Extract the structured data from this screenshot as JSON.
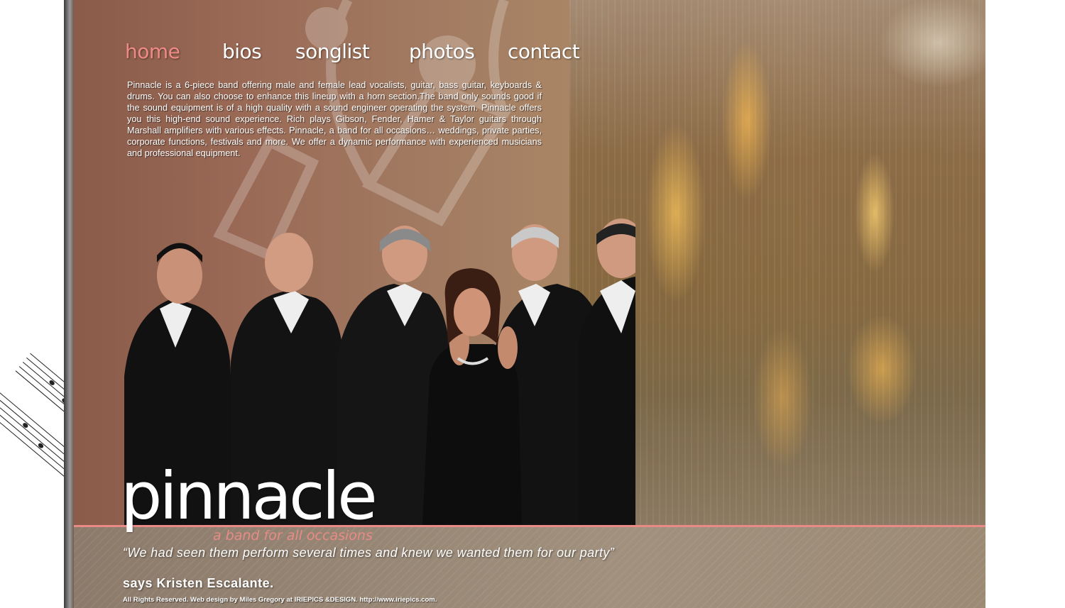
{
  "nav": {
    "items": [
      {
        "label": "home",
        "active": true
      },
      {
        "label": "bios",
        "active": false
      },
      {
        "label": "songlist",
        "active": false
      },
      {
        "label": "photos",
        "active": false
      },
      {
        "label": "contact",
        "active": false
      }
    ]
  },
  "intro": {
    "text": "Pinnacle is a 6-piece band offering male and female lead vocalists, guitar, bass guitar, keyboards & drums. You can also choose to enhance this lineup with a horn section.The band only sounds good if the sound equipment is of a high quality with a sound engineer operating the system. Pinnacle offers you this high-end sound experience. Rich plays Gibson, Fender, Hamer & Taylor guitars through Marshall amplifiers with various effects. Pinnacle, a band for all occasions… weddings, private parties, corporate functions, festivals and more. We offer a dynamic performance with experienced musicians and professional equipment."
  },
  "brand": {
    "logo": "pinnacle",
    "tagline": "a band for all occasions"
  },
  "testimonial": {
    "quote": "“We had seen them perform several times and knew we wanted them for our party”",
    "attribution": "says Kristen Escalante."
  },
  "footer": {
    "credits": "All Rights Reserved. Web design by Miles Gregory at IRIEPICS &DESIGN. http://www.iriepics.com."
  },
  "colors": {
    "accent": "#f08a88",
    "divider": "#e88b86",
    "text": "#ffffff"
  }
}
